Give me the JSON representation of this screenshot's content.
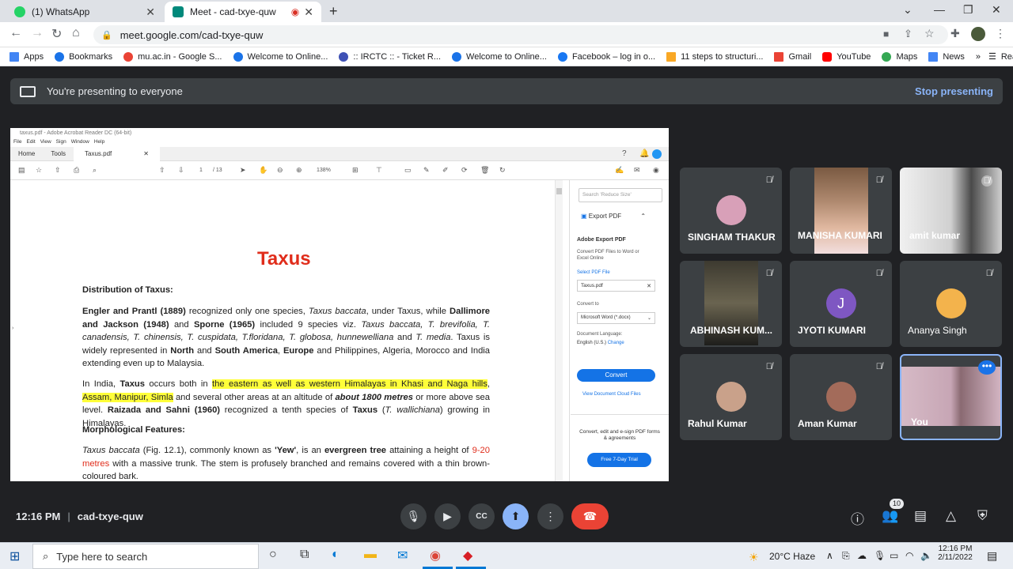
{
  "browser": {
    "tabs": [
      {
        "title": "(1) WhatsApp",
        "favicon_color": "#25d366"
      },
      {
        "title": "Meet - cad-txye-quw",
        "favicon_color": "#00897b"
      }
    ],
    "url": "meet.google.com/cad-txye-quw",
    "bookmarks": [
      {
        "label": "Apps",
        "color": "#4285f4"
      },
      {
        "label": "Bookmarks",
        "color": "#1a73e8"
      },
      {
        "label": "mu.ac.in - Google S...",
        "color": "#ea4335"
      },
      {
        "label": "Welcome to Online...",
        "color": "#1a73e8"
      },
      {
        "label": ":: IRCTC :: - Ticket R...",
        "color": "#3f51b5"
      },
      {
        "label": "Welcome to Online...",
        "color": "#1a73e8"
      },
      {
        "label": "Facebook – log in o...",
        "color": "#1877f2"
      },
      {
        "label": "11 steps to structuri...",
        "color": "#f9a825"
      },
      {
        "label": "Gmail",
        "color": "#ea4335"
      },
      {
        "label": "YouTube",
        "color": "#ff0000"
      },
      {
        "label": "Maps",
        "color": "#34a853"
      },
      {
        "label": "News",
        "color": "#4285f4"
      }
    ],
    "reading_list": "Reading list"
  },
  "meet": {
    "banner_text": "You're presenting to everyone",
    "stop_label": "Stop presenting",
    "time": "12:16 PM",
    "meeting_code": "cad-txye-quw",
    "participant_count": "10",
    "participants": [
      {
        "name": "SINGHAM THAKUR",
        "type": "avatar",
        "color": "#d8a0b8"
      },
      {
        "name": "MANISHA KUMARI",
        "type": "video",
        "color": "#8a6a50"
      },
      {
        "name": "amit kumar",
        "type": "video",
        "color": "#d9dadc"
      },
      {
        "name": "ABHINASH KUM...",
        "type": "video",
        "color": "#5a5548"
      },
      {
        "name": "JYOTI KUMARI",
        "type": "letter",
        "letter": "J",
        "color": "#7e57c2"
      },
      {
        "name": "Ananya Singh",
        "type": "avatar",
        "color": "#f3b34c"
      },
      {
        "name": "Rahul Kumar",
        "type": "avatar",
        "color": "#c9a18a"
      },
      {
        "name": "Aman Kumar",
        "type": "avatar",
        "color": "#a36b5a"
      },
      {
        "name": "You",
        "type": "video",
        "color": "#c7a6b5"
      }
    ]
  },
  "acrobat": {
    "title": "taxus.pdf - Adobe Acrobat Reader DC (64-bit)",
    "menu": [
      "File",
      "Edit",
      "View",
      "Sign",
      "Window",
      "Help"
    ],
    "tabs": [
      "Home",
      "Tools",
      "Taxus.pdf"
    ],
    "page": "1",
    "pages": "/ 13",
    "zoom": "138%",
    "side": {
      "search_placeholder": "Search 'Reduce Size'",
      "export_title": "Export PDF",
      "export_heading": "Adobe Export PDF",
      "export_desc": "Convert PDF Files to Word or Excel Online",
      "select_label": "Select PDF File",
      "file": "Taxus.pdf",
      "convert_to": "Convert to",
      "format": "Microsoft Word (*.docx)",
      "lang_label": "Document Language:",
      "lang": "English (U.S.)",
      "change": "Change",
      "convert_btn": "Convert",
      "view_cloud": "View Document Cloud Files",
      "promo": "Convert, edit and e-sign PDF forms & agreements",
      "trial": "Free 7-Day Trial"
    }
  },
  "document": {
    "title": "Taxus",
    "heading1": "Distribution of Taxus:",
    "heading2": "Morphological Features:"
  },
  "taskbar": {
    "search_placeholder": "Type here to search",
    "weather": "20°C  Haze",
    "time": "12:16 PM",
    "date": "2/11/2022"
  }
}
